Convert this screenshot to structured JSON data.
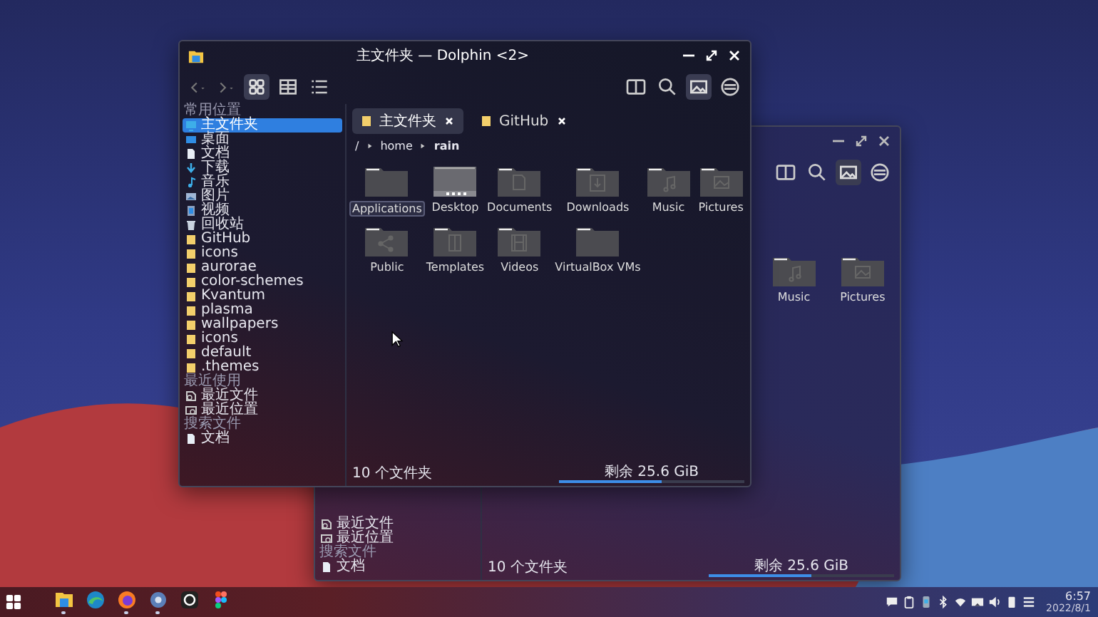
{
  "main_window": {
    "title": "主文件夹 — Dolphin <2>",
    "toolbar": {
      "view_modes": [
        {
          "kind": "icons",
          "selected": true
        },
        {
          "kind": "compact",
          "selected": false
        },
        {
          "kind": "details",
          "selected": false
        }
      ],
      "preview_on": true
    },
    "sidebar": [
      {
        "header": "常用位置",
        "items": [
          {
            "label": "主文件夹",
            "kind": "home",
            "selected": true
          },
          {
            "label": "桌面",
            "kind": "desktop",
            "selected": false
          },
          {
            "label": "文档",
            "kind": "document",
            "selected": false
          },
          {
            "label": "下载",
            "kind": "download",
            "selected": false
          },
          {
            "label": "音乐",
            "kind": "music",
            "selected": false
          },
          {
            "label": "图片",
            "kind": "image",
            "selected": false
          },
          {
            "label": "视频",
            "kind": "video",
            "selected": false
          },
          {
            "label": "回收站",
            "kind": "trash",
            "selected": false
          },
          {
            "label": "GitHub",
            "kind": "folder",
            "selected": false
          },
          {
            "label": "icons",
            "kind": "folder",
            "selected": false
          },
          {
            "label": "aurorae",
            "kind": "folder",
            "selected": false
          },
          {
            "label": "color-schemes",
            "kind": "folder",
            "selected": false
          },
          {
            "label": "Kvantum",
            "kind": "folder",
            "selected": false
          },
          {
            "label": "plasma",
            "kind": "folder",
            "selected": false
          },
          {
            "label": "wallpapers",
            "kind": "folder",
            "selected": false
          },
          {
            "label": "icons",
            "kind": "folder",
            "selected": false
          },
          {
            "label": "default",
            "kind": "folder",
            "selected": false
          },
          {
            "label": ".themes",
            "kind": "folder",
            "selected": false
          }
        ]
      },
      {
        "header": "最近使用",
        "items": [
          {
            "label": "最近文件",
            "kind": "recent-file",
            "selected": false
          },
          {
            "label": "最近位置",
            "kind": "recent-place",
            "selected": false
          }
        ]
      },
      {
        "header": "搜索文件",
        "items": [
          {
            "label": "文档",
            "kind": "document",
            "selected": false
          }
        ]
      }
    ],
    "tabs": [
      {
        "label": "主文件夹",
        "selected": true
      },
      {
        "label": "GitHub",
        "selected": false
      }
    ],
    "breadcrumb": [
      "/",
      "home",
      "rain"
    ],
    "files": [
      {
        "name": "Applications",
        "kind": "plain",
        "selected": true
      },
      {
        "name": "Desktop",
        "kind": "desktop",
        "selected": false
      },
      {
        "name": "Documents",
        "kind": "document",
        "selected": false
      },
      {
        "name": "Downloads",
        "kind": "download",
        "selected": false
      },
      {
        "name": "Music",
        "kind": "music",
        "selected": false
      },
      {
        "name": "Pictures",
        "kind": "image",
        "selected": false
      },
      {
        "name": "Public",
        "kind": "share",
        "selected": false
      },
      {
        "name": "Templates",
        "kind": "template",
        "selected": false
      },
      {
        "name": "Videos",
        "kind": "video",
        "selected": false
      },
      {
        "name": "VirtualBox VMs",
        "kind": "plain",
        "selected": false
      }
    ],
    "status": "10 个文件夹",
    "free_space": {
      "label": "剩余 25.6 GiB",
      "level": 0.55
    }
  },
  "background_window": {
    "toolbar": {
      "preview_on": true
    },
    "sidebar": [
      {
        "items": [
          {
            "label": "最近文件",
            "kind": "recent-file",
            "selected": false
          },
          {
            "label": "最近位置",
            "kind": "recent-place",
            "selected": false
          }
        ]
      },
      {
        "header": "搜索文件",
        "items": [
          {
            "label": "文档",
            "kind": "document",
            "selected": false
          }
        ]
      }
    ],
    "files": [
      {
        "name": "Music",
        "kind": "music",
        "selected": false
      },
      {
        "name": "Pictures",
        "kind": "image",
        "selected": false
      }
    ],
    "status": "10 个文件夹",
    "free_space": {
      "label": "剩余 25.6 GiB",
      "level": 0.55
    }
  },
  "taskbar": {
    "apps": [
      {
        "kind": "files",
        "running": true
      },
      {
        "kind": "browser",
        "running": false
      },
      {
        "kind": "firefox",
        "running": true
      },
      {
        "kind": "settings",
        "running": true
      },
      {
        "kind": "github",
        "running": false
      },
      {
        "kind": "figma",
        "running": false
      }
    ],
    "clock": {
      "time": "6:57",
      "date": "2022/8/1"
    }
  }
}
